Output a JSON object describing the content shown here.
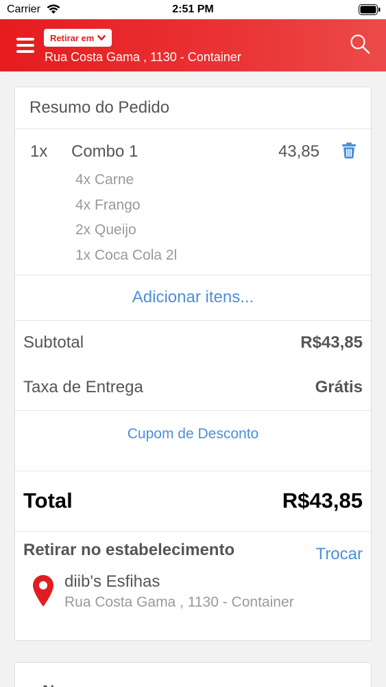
{
  "status_bar": {
    "carrier": "Carrier",
    "time": "2:51 PM"
  },
  "header": {
    "pickup_label": "Retirar em",
    "address": "Rua Costa Gama , 1130 - Container",
    "accent_color": "#e61c1f"
  },
  "summary": {
    "title": "Resumo do Pedido",
    "item": {
      "qty": "1x",
      "name": "Combo 1",
      "price": "43,85",
      "sub_items": [
        "4x Carne",
        "4x Frango",
        "2x Queijo",
        "1x Coca Cola 2l"
      ]
    },
    "add_items_label": "Adicionar itens...",
    "subtotal_label": "Subtotal",
    "subtotal_value": "R$43,85",
    "delivery_label": "Taxa de Entrega",
    "delivery_value": "Grátis",
    "coupon_label": "Cupom de Desconto",
    "total_label": "Total",
    "total_value": "R$43,85"
  },
  "pickup": {
    "title": "Retirar no estabelecimento",
    "change_label": "Trocar",
    "store_name": "diib's Esfihas",
    "store_address": "Rua Costa Gama , 1130 - Container"
  },
  "next_card": {
    "title": "N"
  },
  "colors": {
    "link": "#4a90d9",
    "pin": "#e01e22",
    "trash": "#4a90d9"
  }
}
